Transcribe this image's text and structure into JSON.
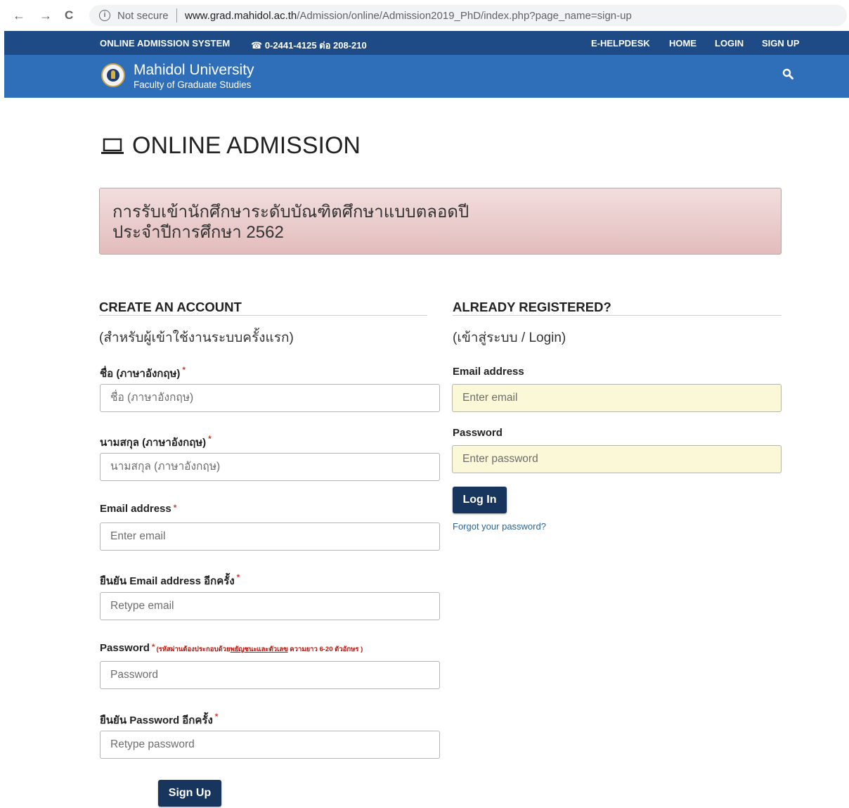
{
  "browser": {
    "back_icon": "←",
    "forward_icon": "→",
    "reload_icon": "C",
    "info_icon": "i",
    "secure_label": "Not secure",
    "url_domain": "www.grad.mahidol.ac.th",
    "url_path": "/Admission/online/Admission2019_PhD/index.php?page_name=sign-up"
  },
  "topbar": {
    "system_label": "ONLINE ADMISSION SYSTEM",
    "phone_icon": "☎",
    "phone": "0-2441-4125 ต่อ 208-210",
    "menu": [
      "E-HELPDESK",
      "HOME",
      "LOGIN",
      "SIGN UP"
    ]
  },
  "header": {
    "title": "Mahidol University",
    "subtitle": "Faculty of Graduate Studies"
  },
  "page": {
    "title": "ONLINE ADMISSION"
  },
  "alert": {
    "line1": "การรับเข้านักศึกษาระดับบัณฑิตศึกษาแบบตลอดปี",
    "line2": "ประจำปีการศึกษา 2562"
  },
  "signup": {
    "heading": "CREATE AN ACCOUNT",
    "note": "(สำหรับผู้เข้าใช้งานระบบครั้งแรก)",
    "required_mark": "*",
    "first_name": {
      "label": "ชื่อ (ภาษาอังกฤษ)",
      "placeholder": "ชื่อ (ภาษาอังกฤษ)"
    },
    "last_name": {
      "label": "นามสกุล (ภาษาอังกฤษ)",
      "placeholder": "นามสกุล (ภาษาอังกฤษ)"
    },
    "email": {
      "label": "Email address",
      "placeholder": "Enter email"
    },
    "email_confirm": {
      "label": "ยืนยัน Email address อีกครั้ง",
      "placeholder": "Retype email"
    },
    "password": {
      "label": "Password",
      "hint_prefix": "(รหัสผ่านต้องประกอบด้วย",
      "hint_emph": "พยัญชนะและตัวเลข",
      "hint_suffix": " ความยาว 6-20 ตัวอักษร )",
      "placeholder": "Password"
    },
    "password_confirm": {
      "label": "ยืนยัน Password อีกครั้ง",
      "placeholder": "Retype password"
    },
    "submit_label": "Sign Up"
  },
  "login": {
    "heading": "ALREADY REGISTERED?",
    "note": "(เข้าสู่ระบบ / Login)",
    "email": {
      "label": "Email address",
      "placeholder": "Enter email"
    },
    "password": {
      "label": "Password",
      "placeholder": "Enter password"
    },
    "submit_label": "Log In",
    "forgot_label": "Forgot your password?"
  },
  "colors": {
    "topbar": "#1e4b86",
    "header": "#2f6fba",
    "button": "#18355d",
    "alert_bg": "#f2dede",
    "required": "#d23b2b",
    "autofill": "#fbf8d7"
  }
}
